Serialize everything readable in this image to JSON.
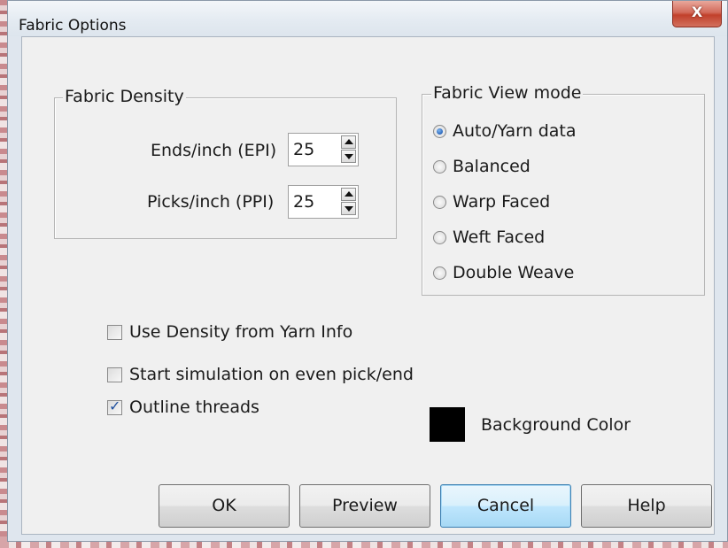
{
  "window": {
    "title": "Fabric Options",
    "close_label": "X"
  },
  "fabric_density": {
    "legend": "Fabric Density",
    "epi_label": "Ends/inch (EPI)",
    "epi_value": "25",
    "ppi_label": "Picks/inch (PPI)",
    "ppi_value": "25"
  },
  "view_mode": {
    "legend": "Fabric View mode",
    "options": [
      {
        "label": "Auto/Yarn data",
        "selected": true
      },
      {
        "label": "Balanced",
        "selected": false
      },
      {
        "label": "Warp Faced",
        "selected": false
      },
      {
        "label": "Weft Faced",
        "selected": false
      },
      {
        "label": "Double Weave",
        "selected": false
      }
    ]
  },
  "checkboxes": [
    {
      "label": "Use Density from Yarn Info",
      "checked": false
    },
    {
      "label": "Start simulation on even pick/end",
      "checked": false
    },
    {
      "label": "Outline threads",
      "checked": true
    }
  ],
  "background_color": {
    "label": "Background Color",
    "value": "#000000"
  },
  "buttons": {
    "ok": "OK",
    "preview": "Preview",
    "cancel": "Cancel",
    "help": "Help"
  }
}
